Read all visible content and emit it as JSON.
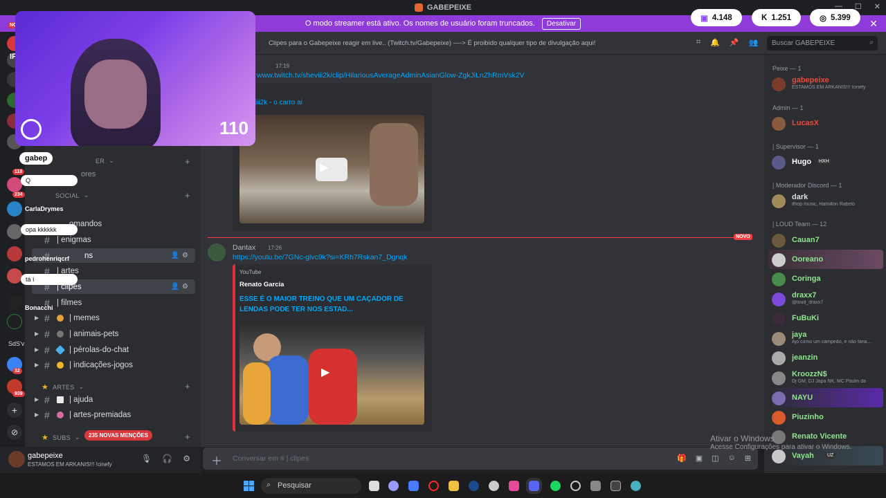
{
  "window": {
    "title": "GABEPEIXE"
  },
  "banner": {
    "text": "O modo streamer está ativo. Os nomes de usuário foram truncados.",
    "button": "Desativar"
  },
  "stats": [
    {
      "icon": "twitch-icon",
      "value": "4.148"
    },
    {
      "icon": "kick-icon",
      "value": "1.251"
    },
    {
      "icon": "globe-icon",
      "value": "5.399"
    }
  ],
  "webcam": {
    "overlay_count": "110"
  },
  "overlay_chat": [
    {
      "user": "gabep",
      "message": "Q"
    },
    {
      "user": "CarlaDrymes",
      "message": "opa kkkkkk"
    },
    {
      "user": "pedrohenriqcrf",
      "message": "tá í"
    },
    {
      "user": "Bonacchi",
      "message": ""
    }
  ],
  "server_rail": {
    "badges": [
      "118",
      "234",
      "32",
      "939"
    ],
    "labels": [
      "NO",
      "IF",
      "SdS'v"
    ]
  },
  "sidebar": {
    "categories": [
      {
        "label": "B___ER",
        "truncated_label": "ER"
      },
      {
        "label": "SOCIAL"
      },
      {
        "label": "ARTES"
      },
      {
        "label": "SUBS"
      }
    ],
    "partial_channel": "ores",
    "channels": [
      {
        "label": "omandos"
      },
      {
        "label": "| enigmas"
      },
      {
        "label": "ns"
      },
      {
        "label": "| artes"
      },
      {
        "label": "| clipes"
      },
      {
        "label": "| filmes"
      },
      {
        "label": "| memes"
      },
      {
        "label": "| animais-pets"
      },
      {
        "label": "| pérolas-do-chat"
      },
      {
        "label": "| indicações-jogos"
      },
      {
        "label": "| ajuda"
      },
      {
        "label": "| artes-premiadas"
      }
    ],
    "mentions_badge": "235 NOVAS MENÇÕES"
  },
  "user_panel": {
    "name": "gabepeixe",
    "status": "ESTAMOS EM ARKANIS!!! !cinefy"
  },
  "header": {
    "topic": "Clipes para o Gabepeixe reagir em live.. (Twitch.tv/Gabepeixe) ----> É proibido qualquer tipo de divulgação aqui!",
    "search_placeholder": "Buscar GABEPEIXE"
  },
  "messages": [
    {
      "time": "17:19",
      "link": "www.twitch.tv/sheviii2k/clip/HilariousAverageAdminAsianGlow-ZgkJiLnZhRmVsk2V",
      "embed_title": "iii2k - o carro ai"
    },
    {
      "author": "Dantax",
      "time": "17:26",
      "link": "https://youtu.be/7GNc-glvc9k?si=KRh7Rskan7_Dgnqk",
      "embed_provider": "YouTube",
      "embed_author": "Renato Garcia",
      "embed_title": "ESSE É O MAIOR TREINO QUE UM CAÇADOR DE LENDAS PODE TER NOS ESTAD..."
    }
  ],
  "new_divider": "NOVO",
  "composer": {
    "placeholder": "Conversar em # | clipes"
  },
  "members": {
    "groups": [
      {
        "label": "Peixe — 1"
      },
      {
        "label": "Admin — 1"
      },
      {
        "label": "| Supervisor — 1"
      },
      {
        "label": "| Moderador Discord — 1"
      },
      {
        "label": "| LOUD Team — 12"
      }
    ],
    "list": [
      {
        "name": "gabepeixe",
        "sub": "ESTAMOS EM ARKANIS!!! !cinefy",
        "color": "#e84a3c"
      },
      {
        "name": "LucasX",
        "sub": "",
        "color": "#e84a3c"
      },
      {
        "name": "Hugo",
        "tag": "HXH",
        "sub": "",
        "color": "#ffffff"
      },
      {
        "name": "dark",
        "sub": "ifhop music, Hamilton Rabelo",
        "color": "#dbdee1"
      },
      {
        "name": "Cauan7",
        "sub": "",
        "color": "#8ee68f"
      },
      {
        "name": "Ooreano",
        "sub": "",
        "color": "#8ee68f"
      },
      {
        "name": "Coringa",
        "sub": "",
        "color": "#8ee68f"
      },
      {
        "name": "draxx7",
        "sub": "@loud_draxx7",
        "color": "#8ee68f"
      },
      {
        "name": "FuBuKi",
        "sub": "",
        "color": "#8ee68f"
      },
      {
        "name": "jaya",
        "sub": "Ajo como um campeão, e não faria...",
        "color": "#8ee68f"
      },
      {
        "name": "jeanzin",
        "sub": "",
        "color": "#8ee68f"
      },
      {
        "name": "KroozzN$",
        "sub": "Dj GM, DJ Japa NK, MC Paulin da",
        "color": "#8ee68f"
      },
      {
        "name": "NAYU",
        "sub": "",
        "color": "#8ee68f"
      },
      {
        "name": "Piuzinho",
        "sub": "",
        "color": "#8ee68f"
      },
      {
        "name": "Renato Vicente",
        "sub": "",
        "color": "#8ee68f"
      },
      {
        "name": "Vayah",
        "tag": "UZ",
        "sub": "",
        "color": "#8ee68f"
      }
    ]
  },
  "windows_activation": {
    "title": "Ativar o Windows",
    "sub": "Acesse Configurações para ativar o Windows."
  },
  "taskbar": {
    "search_placeholder": "Pesquisar"
  }
}
